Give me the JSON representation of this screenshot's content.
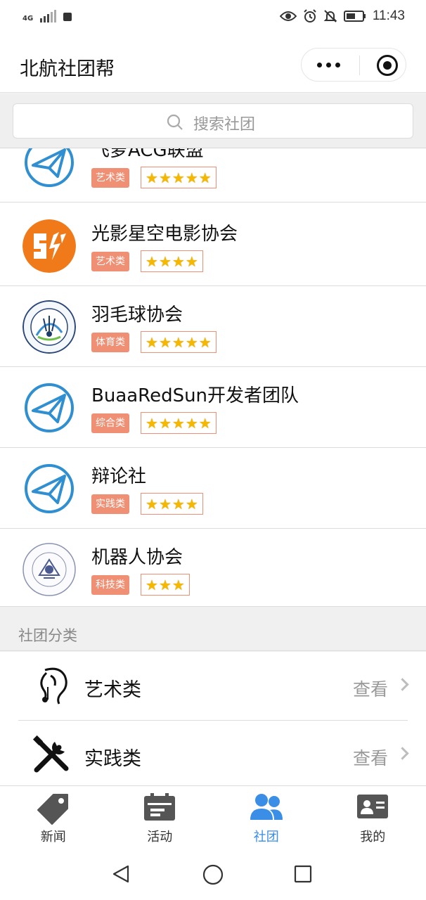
{
  "status_bar": {
    "network": "4G",
    "time": "11:43"
  },
  "nav": {
    "title": "北航社团帮"
  },
  "search": {
    "placeholder": "搜索社团"
  },
  "clubs": [
    {
      "name": "飞萝ACG联盟",
      "category": "艺术类",
      "stars": 5,
      "logo": "paper-plane-logo"
    },
    {
      "name": "光影星空电影协会",
      "category": "艺术类",
      "stars": 4,
      "logo": "movie-association-logo"
    },
    {
      "name": "羽毛球协会",
      "category": "体育类",
      "stars": 5,
      "logo": "badminton-association-logo"
    },
    {
      "name": "BuaaRedSun开发者团队",
      "category": "综合类",
      "stars": 5,
      "logo": "paper-plane-logo"
    },
    {
      "name": "辩论社",
      "category": "实践类",
      "stars": 4,
      "logo": "paper-plane-logo"
    },
    {
      "name": "机器人协会",
      "category": "科技类",
      "stars": 3,
      "logo": "robot-association-logo"
    }
  ],
  "categories": {
    "header": "社团分类",
    "items": [
      {
        "name": "艺术类",
        "action": "查看",
        "icon": "art-icon"
      },
      {
        "name": "实践类",
        "action": "查看",
        "icon": "tools-icon"
      }
    ]
  },
  "tabs": [
    {
      "label": "新闻",
      "icon": "tag-icon",
      "active": false
    },
    {
      "label": "活动",
      "icon": "calendar-icon",
      "active": false
    },
    {
      "label": "社团",
      "icon": "people-icon",
      "active": true
    },
    {
      "label": "我的",
      "icon": "id-card-icon",
      "active": false
    }
  ],
  "colors": {
    "tag_bg": "#ef8f74",
    "star": "#f5b800",
    "accent": "#3a8ee6",
    "plane": "#2f8fd0"
  }
}
